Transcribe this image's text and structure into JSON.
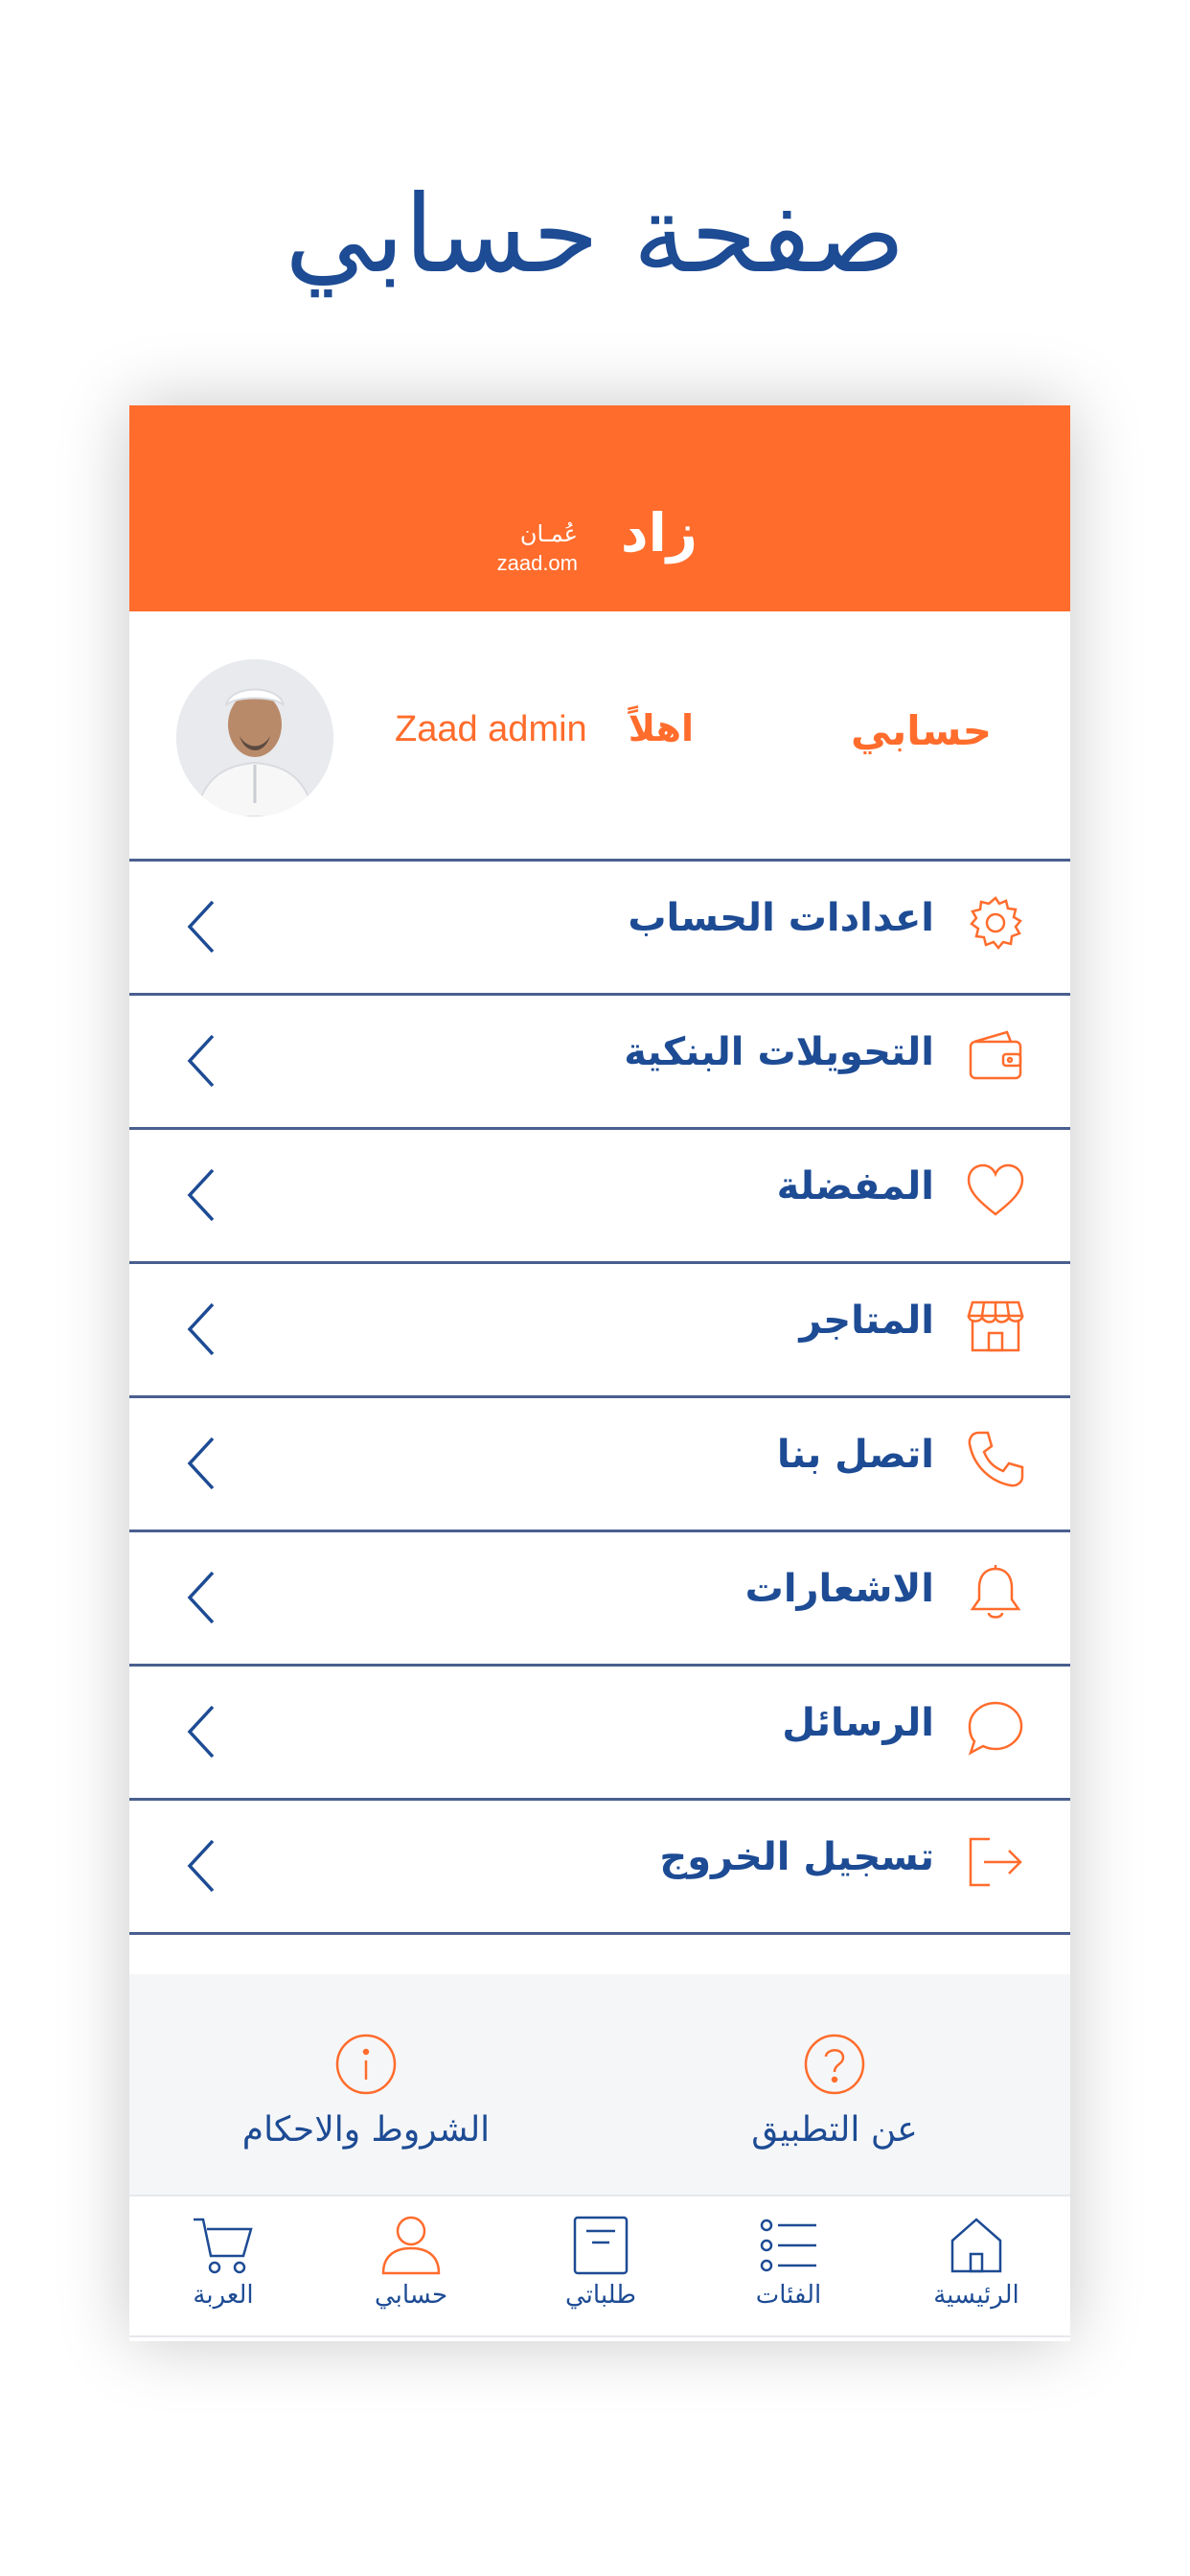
{
  "page": {
    "title": "صفحة حسابي"
  },
  "brand": {
    "logo_text": "زاد",
    "logo_sub": "zaad.om",
    "logo_arabic": "عُمـان",
    "color_orange": "#ff6c2c",
    "color_blue": "#1d4b94"
  },
  "profile": {
    "section_title": "حسابي",
    "greeting": "اهلاً",
    "username": "Zaad admin"
  },
  "menu": [
    {
      "label": "اعدادات الحساب",
      "icon": "gear-icon"
    },
    {
      "label": "التحويلات البنكية",
      "icon": "wallet-icon"
    },
    {
      "label": "المفضلة",
      "icon": "heart-icon"
    },
    {
      "label": "المتاجر",
      "icon": "store-icon"
    },
    {
      "label": "اتصل بنا",
      "icon": "phone-icon"
    },
    {
      "label": "الاشعارات",
      "icon": "bell-icon"
    },
    {
      "label": "الرسائل",
      "icon": "chat-icon"
    },
    {
      "label": "تسجيل الخروج",
      "icon": "logout-icon"
    }
  ],
  "footer_links": {
    "about": "عن التطبيق",
    "terms": "الشروط والاحكام"
  },
  "tabs": {
    "home": "الرئيسية",
    "categories": "الفئات",
    "orders": "طلباتي",
    "account": "حسابي",
    "cart": "العربة"
  }
}
